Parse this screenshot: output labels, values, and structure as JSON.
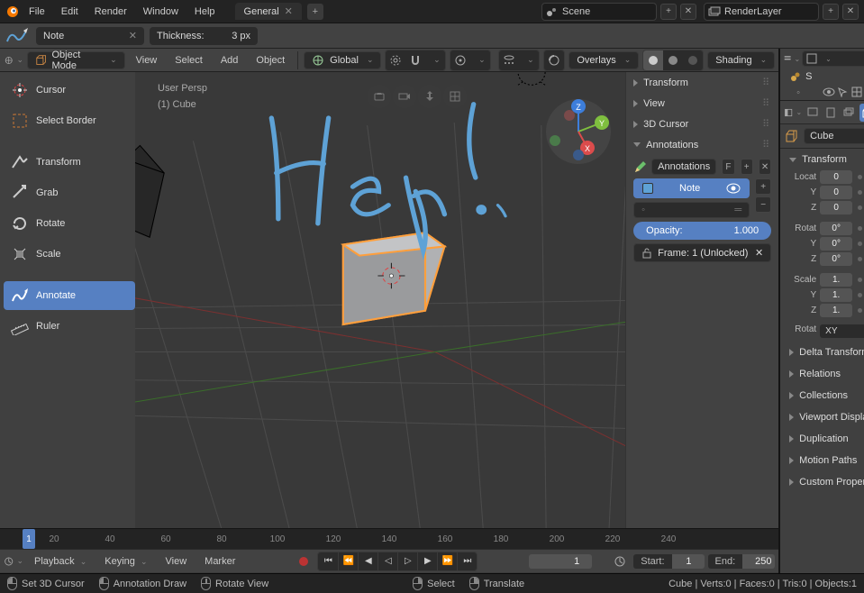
{
  "menu": {
    "file": "File",
    "edit": "Edit",
    "render": "Render",
    "window": "Window",
    "help": "Help"
  },
  "tab": {
    "name": "General"
  },
  "scene_field": {
    "value": "Scene"
  },
  "layer_field": {
    "value": "RenderLayer"
  },
  "tool_settings": {
    "note_layer": "Note",
    "thickness_label": "Thickness:",
    "thickness_value": "3 px"
  },
  "vp_header": {
    "mode": "Object Mode",
    "view": "View",
    "select": "Select",
    "add": "Add",
    "object": "Object",
    "orientation": "Global",
    "overlays": "Overlays",
    "shading": "Shading"
  },
  "toolbar": {
    "cursor": "Cursor",
    "select_border": "Select Border",
    "transform": "Transform",
    "grab": "Grab",
    "rotate": "Rotate",
    "scale": "Scale",
    "annotate": "Annotate",
    "ruler": "Ruler"
  },
  "viewport_info": {
    "persp": "User Persp",
    "object": "(1) Cube"
  },
  "npanel": {
    "transform": "Transform",
    "view": "View",
    "cursor": "3D Cursor",
    "annotations": "Annotations",
    "annot_field": "Annotations",
    "fake": "F",
    "note": "Note",
    "opacity_label": "Opacity:",
    "opacity_value": "1.000",
    "frame_label": "Frame: 1 (Unlocked)"
  },
  "props": {
    "object_name": "Cube",
    "transform": "Transform",
    "location": "Locat",
    "rotation": "Rotat",
    "scale": "Scale",
    "axes": {
      "y": "Y",
      "z": "Z"
    },
    "loc": {
      "x": "0",
      "y": "0",
      "z": "0"
    },
    "rot": {
      "x": "0°",
      "y": "0°",
      "z": "0°"
    },
    "scl": {
      "x": "1.",
      "y": "1.",
      "z": "1."
    },
    "rot_mode_label": "Rotat",
    "rot_mode": "XY",
    "delta": "Delta Transform",
    "relations": "Relations",
    "collections": "Collections",
    "viewport": "Viewport Display",
    "duplication": "Duplication",
    "motion": "Motion Paths",
    "custom": "Custom Properties"
  },
  "timeline": {
    "ticks": [
      "20",
      "40",
      "60",
      "80",
      "100",
      "120",
      "140",
      "160",
      "180",
      "200",
      "220",
      "240"
    ],
    "current": "1",
    "playback": "Playback",
    "keying": "Keying",
    "view": "View",
    "marker": "Marker",
    "frame_field": "1",
    "start_label": "Start:",
    "start_val": "1",
    "end_label": "End:",
    "end_val": "250"
  },
  "status": {
    "set_cursor": "Set 3D Cursor",
    "annot_draw": "Annotation Draw",
    "rotate_view": "Rotate View",
    "select": "Select",
    "translate": "Translate",
    "stats": "Cube | Verts:0 | Faces:0 | Tris:0 | Objects:1"
  },
  "outliner": {
    "scene": "S"
  }
}
